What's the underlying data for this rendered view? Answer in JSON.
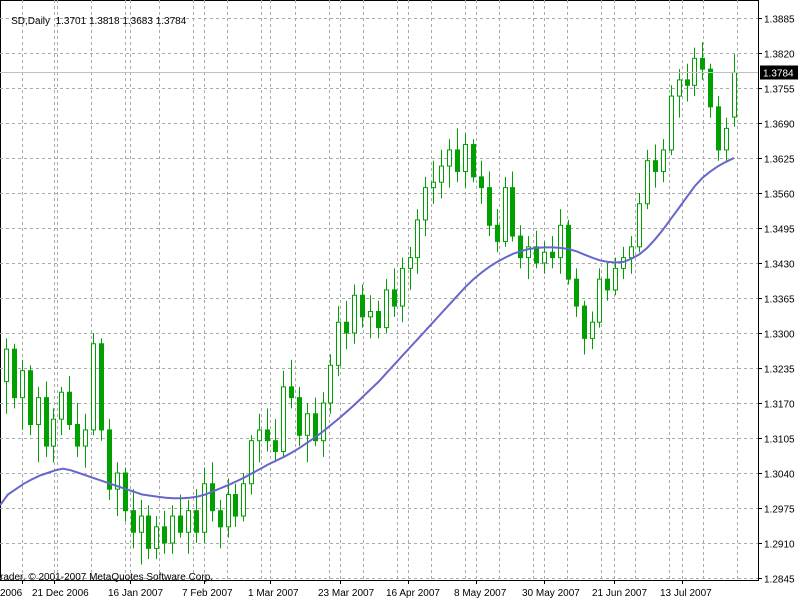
{
  "header": {
    "symbol": "SD,Daily",
    "open": "1.3701",
    "high": "1.3818",
    "low": "1.3683",
    "close": "1.3784"
  },
  "copyright": "rader, © 2001-2007 MetaQuotes Software Corp.",
  "chart_data": {
    "type": "candlestick",
    "title": "SD,Daily",
    "ylim": [
      1.2845,
      1.3885
    ],
    "y_ticks": [
      "1.3885",
      "1.3820",
      "1.3755",
      "1.3690",
      "1.3625",
      "1.3560",
      "1.3495",
      "1.3430",
      "1.3365",
      "1.3300",
      "1.3235",
      "1.3170",
      "1.3105",
      "1.3040",
      "1.2975",
      "1.2910",
      "1.2845"
    ],
    "x_tick_labels": [
      "2006",
      "21 Dec 2006",
      "16 Jan 2007",
      "7 Feb 2007",
      "1 Mar 2007",
      "23 Mar 2007",
      "16 Apr 2007",
      "8 May 2007",
      "30 May 2007",
      "21 Jun 2007",
      "13 Jul 2007"
    ],
    "current_price": "1.3784",
    "grid": true,
    "colors": {
      "bull": "#00a000",
      "bear": "#00a000",
      "ma": "#6666cc",
      "grid": "#aaaaaa",
      "price_box": "#000000"
    },
    "candles": [
      {
        "date": "Dec 2006",
        "o": 1.321,
        "h": 1.329,
        "l": 1.315,
        "c": 1.327
      },
      {
        "date": "Dec 2006",
        "o": 1.327,
        "h": 1.328,
        "l": 1.316,
        "c": 1.318
      },
      {
        "date": "Dec 2006",
        "o": 1.318,
        "h": 1.325,
        "l": 1.312,
        "c": 1.323
      },
      {
        "date": "Dec 2006",
        "o": 1.323,
        "h": 1.324,
        "l": 1.311,
        "c": 1.313
      },
      {
        "date": "Dec 2006",
        "o": 1.313,
        "h": 1.32,
        "l": 1.306,
        "c": 1.318
      },
      {
        "date": "Dec 2006",
        "o": 1.318,
        "h": 1.321,
        "l": 1.307,
        "c": 1.309
      },
      {
        "date": "21 Dec 2006",
        "o": 1.309,
        "h": 1.316,
        "l": 1.306,
        "c": 1.314
      },
      {
        "date": "21 Dec 2006",
        "o": 1.314,
        "h": 1.32,
        "l": 1.311,
        "c": 1.319
      },
      {
        "date": "21 Dec 2006",
        "o": 1.319,
        "h": 1.322,
        "l": 1.312,
        "c": 1.313
      },
      {
        "date": "21 Dec 2006",
        "o": 1.313,
        "h": 1.317,
        "l": 1.307,
        "c": 1.309
      },
      {
        "date": "21 Dec 2006",
        "o": 1.309,
        "h": 1.315,
        "l": 1.305,
        "c": 1.312
      },
      {
        "date": "21 Dec 2006",
        "o": 1.312,
        "h": 1.33,
        "l": 1.311,
        "c": 1.328
      },
      {
        "date": "21 Dec 2006",
        "o": 1.328,
        "h": 1.329,
        "l": 1.31,
        "c": 1.312
      },
      {
        "date": "21 Dec 2006",
        "o": 1.312,
        "h": 1.314,
        "l": 1.299,
        "c": 1.301
      },
      {
        "date": "21 Dec 2006",
        "o": 1.301,
        "h": 1.306,
        "l": 1.296,
        "c": 1.304
      },
      {
        "date": "21 Dec 2006",
        "o": 1.304,
        "h": 1.305,
        "l": 1.295,
        "c": 1.297
      },
      {
        "date": "21 Dec 2006",
        "o": 1.297,
        "h": 1.301,
        "l": 1.29,
        "c": 1.293
      },
      {
        "date": "21 Dec 2006",
        "o": 1.293,
        "h": 1.299,
        "l": 1.287,
        "c": 1.296
      },
      {
        "date": "16 Jan 2007",
        "o": 1.296,
        "h": 1.298,
        "l": 1.288,
        "c": 1.29
      },
      {
        "date": "16 Jan 2007",
        "o": 1.29,
        "h": 1.296,
        "l": 1.288,
        "c": 1.294
      },
      {
        "date": "16 Jan 2007",
        "o": 1.294,
        "h": 1.297,
        "l": 1.289,
        "c": 1.291
      },
      {
        "date": "16 Jan 2007",
        "o": 1.291,
        "h": 1.298,
        "l": 1.289,
        "c": 1.296
      },
      {
        "date": "16 Jan 2007",
        "o": 1.296,
        "h": 1.3,
        "l": 1.292,
        "c": 1.293
      },
      {
        "date": "16 Jan 2007",
        "o": 1.293,
        "h": 1.299,
        "l": 1.289,
        "c": 1.297
      },
      {
        "date": "16 Jan 2007",
        "o": 1.297,
        "h": 1.301,
        "l": 1.291,
        "c": 1.293
      },
      {
        "date": "16 Jan 2007",
        "o": 1.293,
        "h": 1.305,
        "l": 1.291,
        "c": 1.302
      },
      {
        "date": "16 Jan 2007",
        "o": 1.302,
        "h": 1.306,
        "l": 1.295,
        "c": 1.297
      },
      {
        "date": "16 Jan 2007",
        "o": 1.297,
        "h": 1.299,
        "l": 1.29,
        "c": 1.294
      },
      {
        "date": "7 Feb 2007",
        "o": 1.294,
        "h": 1.303,
        "l": 1.292,
        "c": 1.3
      },
      {
        "date": "7 Feb 2007",
        "o": 1.3,
        "h": 1.302,
        "l": 1.294,
        "c": 1.296
      },
      {
        "date": "7 Feb 2007",
        "o": 1.296,
        "h": 1.304,
        "l": 1.295,
        "c": 1.302
      },
      {
        "date": "7 Feb 2007",
        "o": 1.302,
        "h": 1.311,
        "l": 1.3,
        "c": 1.31
      },
      {
        "date": "7 Feb 2007",
        "o": 1.31,
        "h": 1.315,
        "l": 1.306,
        "c": 1.312
      },
      {
        "date": "7 Feb 2007",
        "o": 1.312,
        "h": 1.316,
        "l": 1.308,
        "c": 1.31
      },
      {
        "date": "7 Feb 2007",
        "o": 1.31,
        "h": 1.314,
        "l": 1.306,
        "c": 1.308
      },
      {
        "date": "7 Feb 2007",
        "o": 1.308,
        "h": 1.323,
        "l": 1.307,
        "c": 1.32
      },
      {
        "date": "7 Feb 2007",
        "o": 1.32,
        "h": 1.325,
        "l": 1.316,
        "c": 1.318
      },
      {
        "date": "7 Feb 2007",
        "o": 1.318,
        "h": 1.32,
        "l": 1.309,
        "c": 1.311
      },
      {
        "date": "1 Mar 2007",
        "o": 1.311,
        "h": 1.317,
        "l": 1.306,
        "c": 1.315
      },
      {
        "date": "1 Mar 2007",
        "o": 1.315,
        "h": 1.318,
        "l": 1.309,
        "c": 1.31
      },
      {
        "date": "1 Mar 2007",
        "o": 1.31,
        "h": 1.319,
        "l": 1.307,
        "c": 1.317
      },
      {
        "date": "1 Mar 2007",
        "o": 1.317,
        "h": 1.326,
        "l": 1.315,
        "c": 1.324
      },
      {
        "date": "1 Mar 2007",
        "o": 1.324,
        "h": 1.335,
        "l": 1.322,
        "c": 1.332
      },
      {
        "date": "1 Mar 2007",
        "o": 1.332,
        "h": 1.336,
        "l": 1.327,
        "c": 1.33
      },
      {
        "date": "1 Mar 2007",
        "o": 1.33,
        "h": 1.339,
        "l": 1.328,
        "c": 1.337
      },
      {
        "date": "1 Mar 2007",
        "o": 1.337,
        "h": 1.339,
        "l": 1.331,
        "c": 1.333
      },
      {
        "date": "23 Mar 2007",
        "o": 1.333,
        "h": 1.337,
        "l": 1.329,
        "c": 1.334
      },
      {
        "date": "23 Mar 2007",
        "o": 1.334,
        "h": 1.336,
        "l": 1.329,
        "c": 1.331
      },
      {
        "date": "23 Mar 2007",
        "o": 1.331,
        "h": 1.34,
        "l": 1.33,
        "c": 1.338
      },
      {
        "date": "23 Mar 2007",
        "o": 1.338,
        "h": 1.342,
        "l": 1.333,
        "c": 1.335
      },
      {
        "date": "23 Mar 2007",
        "o": 1.335,
        "h": 1.344,
        "l": 1.332,
        "c": 1.342
      },
      {
        "date": "23 Mar 2007",
        "o": 1.342,
        "h": 1.346,
        "l": 1.338,
        "c": 1.344
      },
      {
        "date": "23 Mar 2007",
        "o": 1.344,
        "h": 1.353,
        "l": 1.341,
        "c": 1.351
      },
      {
        "date": "16 Apr 2007",
        "o": 1.351,
        "h": 1.359,
        "l": 1.348,
        "c": 1.357
      },
      {
        "date": "16 Apr 2007",
        "o": 1.357,
        "h": 1.362,
        "l": 1.354,
        "c": 1.358
      },
      {
        "date": "16 Apr 2007",
        "o": 1.358,
        "h": 1.364,
        "l": 1.355,
        "c": 1.361
      },
      {
        "date": "16 Apr 2007",
        "o": 1.361,
        "h": 1.366,
        "l": 1.357,
        "c": 1.364
      },
      {
        "date": "16 Apr 2007",
        "o": 1.364,
        "h": 1.368,
        "l": 1.358,
        "c": 1.36
      },
      {
        "date": "16 Apr 2007",
        "o": 1.36,
        "h": 1.367,
        "l": 1.357,
        "c": 1.365
      },
      {
        "date": "16 Apr 2007",
        "o": 1.365,
        "h": 1.366,
        "l": 1.358,
        "c": 1.359
      },
      {
        "date": "16 Apr 2007",
        "o": 1.359,
        "h": 1.362,
        "l": 1.354,
        "c": 1.357
      },
      {
        "date": "16 Apr 2007",
        "o": 1.357,
        "h": 1.36,
        "l": 1.348,
        "c": 1.35
      },
      {
        "date": "8 May 2007",
        "o": 1.35,
        "h": 1.353,
        "l": 1.345,
        "c": 1.347
      },
      {
        "date": "8 May 2007",
        "o": 1.347,
        "h": 1.359,
        "l": 1.346,
        "c": 1.357
      },
      {
        "date": "8 May 2007",
        "o": 1.357,
        "h": 1.36,
        "l": 1.347,
        "c": 1.348
      },
      {
        "date": "8 May 2007",
        "o": 1.348,
        "h": 1.35,
        "l": 1.342,
        "c": 1.344
      },
      {
        "date": "8 May 2007",
        "o": 1.344,
        "h": 1.348,
        "l": 1.34,
        "c": 1.346
      },
      {
        "date": "8 May 2007",
        "o": 1.346,
        "h": 1.349,
        "l": 1.342,
        "c": 1.343
      },
      {
        "date": "8 May 2007",
        "o": 1.343,
        "h": 1.347,
        "l": 1.341,
        "c": 1.345
      },
      {
        "date": "8 May 2007",
        "o": 1.345,
        "h": 1.348,
        "l": 1.342,
        "c": 1.344
      },
      {
        "date": "30 May 2007",
        "o": 1.344,
        "h": 1.353,
        "l": 1.341,
        "c": 1.35
      },
      {
        "date": "30 May 2007",
        "o": 1.35,
        "h": 1.351,
        "l": 1.339,
        "c": 1.34
      },
      {
        "date": "30 May 2007",
        "o": 1.34,
        "h": 1.342,
        "l": 1.333,
        "c": 1.335
      },
      {
        "date": "30 May 2007",
        "o": 1.335,
        "h": 1.336,
        "l": 1.326,
        "c": 1.329
      },
      {
        "date": "30 May 2007",
        "o": 1.329,
        "h": 1.334,
        "l": 1.327,
        "c": 1.332
      },
      {
        "date": "30 May 2007",
        "o": 1.332,
        "h": 1.342,
        "l": 1.331,
        "c": 1.34
      },
      {
        "date": "30 May 2007",
        "o": 1.34,
        "h": 1.343,
        "l": 1.336,
        "c": 1.338
      },
      {
        "date": "21 Jun 2007",
        "o": 1.338,
        "h": 1.344,
        "l": 1.337,
        "c": 1.342
      },
      {
        "date": "21 Jun 2007",
        "o": 1.342,
        "h": 1.346,
        "l": 1.34,
        "c": 1.344
      },
      {
        "date": "21 Jun 2007",
        "o": 1.344,
        "h": 1.348,
        "l": 1.341,
        "c": 1.346
      },
      {
        "date": "21 Jun 2007",
        "o": 1.346,
        "h": 1.356,
        "l": 1.345,
        "c": 1.354
      },
      {
        "date": "21 Jun 2007",
        "o": 1.354,
        "h": 1.364,
        "l": 1.353,
        "c": 1.362
      },
      {
        "date": "21 Jun 2007",
        "o": 1.362,
        "h": 1.365,
        "l": 1.357,
        "c": 1.36
      },
      {
        "date": "21 Jun 2007",
        "o": 1.36,
        "h": 1.366,
        "l": 1.358,
        "c": 1.364
      },
      {
        "date": "13 Jul 2007",
        "o": 1.364,
        "h": 1.376,
        "l": 1.363,
        "c": 1.374
      },
      {
        "date": "13 Jul 2007",
        "o": 1.374,
        "h": 1.379,
        "l": 1.37,
        "c": 1.377
      },
      {
        "date": "13 Jul 2007",
        "o": 1.377,
        "h": 1.38,
        "l": 1.373,
        "c": 1.376
      },
      {
        "date": "13 Jul 2007",
        "o": 1.376,
        "h": 1.383,
        "l": 1.374,
        "c": 1.381
      },
      {
        "date": "13 Jul 2007",
        "o": 1.381,
        "h": 1.384,
        "l": 1.377,
        "c": 1.379
      },
      {
        "date": "13 Jul 2007",
        "o": 1.379,
        "h": 1.38,
        "l": 1.37,
        "c": 1.372
      },
      {
        "date": "13 Jul 2007",
        "o": 1.372,
        "h": 1.374,
        "l": 1.362,
        "c": 1.364
      },
      {
        "date": "13 Jul 2007",
        "o": 1.364,
        "h": 1.37,
        "l": 1.362,
        "c": 1.368
      },
      {
        "date": "13 Jul 2007",
        "o": 1.3701,
        "h": 1.3818,
        "l": 1.3683,
        "c": 1.3784
      }
    ],
    "ma": [
      1.298,
      1.3,
      1.301,
      1.302,
      1.3028,
      1.3035,
      1.304,
      1.3045,
      1.3048,
      1.3045,
      1.304,
      1.3035,
      1.303,
      1.3025,
      1.302,
      1.3015,
      1.301,
      1.3005,
      1.3,
      1.2998,
      1.2996,
      1.2994,
      1.2993,
      1.2993,
      1.2994,
      1.2996,
      1.3,
      1.3006,
      1.3012,
      1.3018,
      1.3025,
      1.3032,
      1.304,
      1.3048,
      1.3056,
      1.3063,
      1.307,
      1.3078,
      1.3087,
      1.3097,
      1.3107,
      1.3118,
      1.313,
      1.3142,
      1.3155,
      1.3168,
      1.3182,
      1.3196,
      1.321,
      1.3226,
      1.3242,
      1.3258,
      1.3274,
      1.329,
      1.3306,
      1.3322,
      1.3338,
      1.3354,
      1.337,
      1.3386,
      1.34,
      1.3412,
      1.3423,
      1.3432,
      1.344,
      1.3447,
      1.3452,
      1.3456,
      1.3458,
      1.3459,
      1.3459,
      1.3458,
      1.3456,
      1.3452,
      1.3446,
      1.344,
      1.3435,
      1.3432,
      1.3431,
      1.3432,
      1.3438,
      1.3446,
      1.3458,
      1.3474,
      1.3492,
      1.3512,
      1.3532,
      1.3552,
      1.3572,
      1.3588,
      1.36,
      1.361,
      1.3618,
      1.3625
    ]
  }
}
